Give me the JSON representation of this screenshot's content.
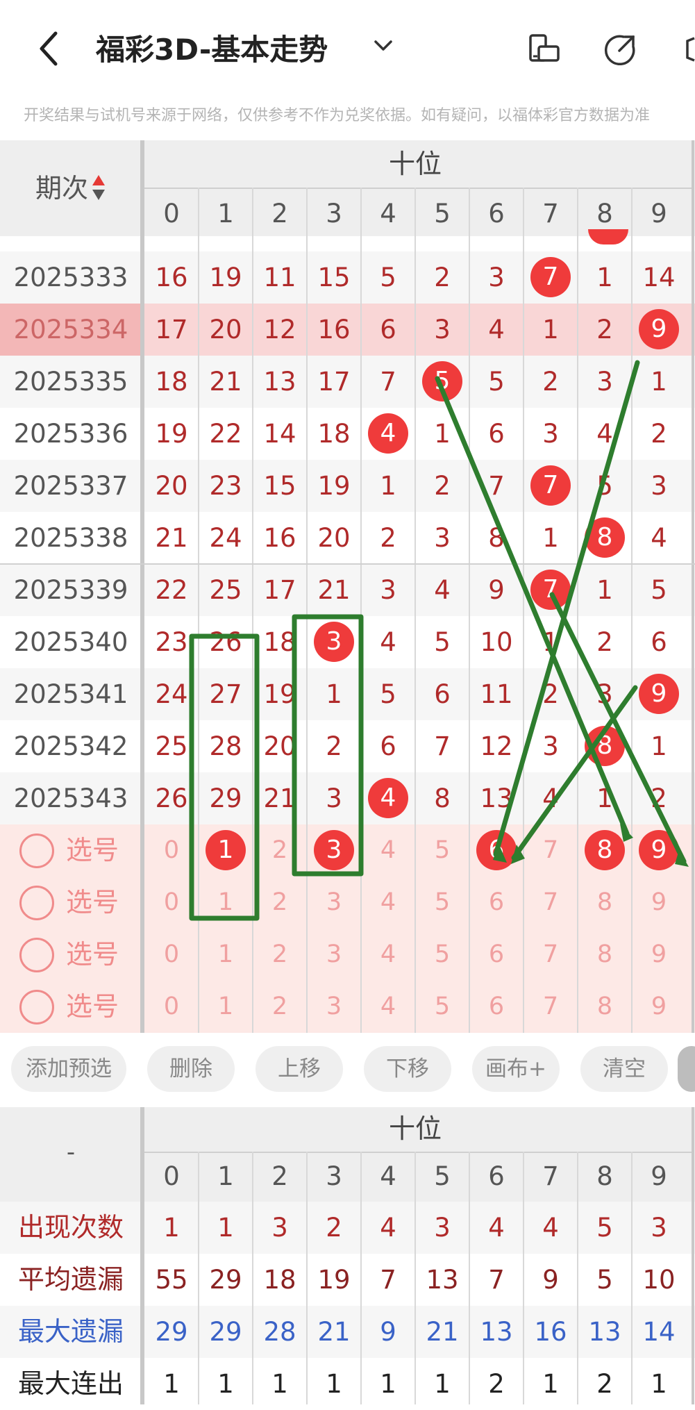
{
  "header": {
    "back_icon": "chevron-left-icon",
    "title": "福彩3D-基本走势",
    "dropdown_icon": "chevron-down-icon",
    "icons": [
      "phone-rotate-icon",
      "share-icon",
      "more-icon"
    ]
  },
  "notice": "开奖结果与试机号来源于网络，仅供参考不作为兑奖依据。如有疑问，以福体彩官方数据为准",
  "table": {
    "period_header": "期次",
    "group_header": "十位",
    "digits": [
      "0",
      "1",
      "2",
      "3",
      "4",
      "5",
      "6",
      "7",
      "8",
      "9"
    ],
    "rows": [
      {
        "period": "2025333",
        "values": [
          "16",
          "19",
          "11",
          "15",
          "5",
          "2",
          "3",
          "7",
          "1",
          "14"
        ],
        "hit": 7,
        "highlight": false
      },
      {
        "period": "2025334",
        "values": [
          "17",
          "20",
          "12",
          "16",
          "6",
          "3",
          "4",
          "1",
          "2",
          "9"
        ],
        "hit": 9,
        "highlight": true
      },
      {
        "period": "2025335",
        "values": [
          "18",
          "21",
          "13",
          "17",
          "7",
          "5",
          "5",
          "2",
          "3",
          "1"
        ],
        "hit": 5,
        "highlight": false
      },
      {
        "period": "2025336",
        "values": [
          "19",
          "22",
          "14",
          "18",
          "4",
          "1",
          "6",
          "3",
          "4",
          "2"
        ],
        "hit": 4,
        "highlight": false
      },
      {
        "period": "2025337",
        "values": [
          "20",
          "23",
          "15",
          "19",
          "1",
          "2",
          "7",
          "7",
          "5",
          "3"
        ],
        "hit": 7,
        "highlight": false
      },
      {
        "period": "2025338",
        "values": [
          "21",
          "24",
          "16",
          "20",
          "2",
          "3",
          "8",
          "1",
          "8",
          "4"
        ],
        "hit": 8,
        "highlight": false
      },
      {
        "period": "2025339",
        "values": [
          "22",
          "25",
          "17",
          "21",
          "3",
          "4",
          "9",
          "7",
          "1",
          "5"
        ],
        "hit": 7,
        "highlight": false
      },
      {
        "period": "2025340",
        "values": [
          "23",
          "26",
          "18",
          "3",
          "4",
          "5",
          "10",
          "1",
          "2",
          "6"
        ],
        "hit": 3,
        "highlight": false
      },
      {
        "period": "2025341",
        "values": [
          "24",
          "27",
          "19",
          "1",
          "5",
          "6",
          "11",
          "2",
          "3",
          "9"
        ],
        "hit": 9,
        "highlight": false
      },
      {
        "period": "2025342",
        "values": [
          "25",
          "28",
          "20",
          "2",
          "6",
          "7",
          "12",
          "3",
          "8",
          "1"
        ],
        "hit": 8,
        "highlight": false
      },
      {
        "period": "2025343",
        "values": [
          "26",
          "29",
          "21",
          "3",
          "4",
          "8",
          "13",
          "4",
          "1",
          "2"
        ],
        "hit": 4,
        "highlight": false
      }
    ],
    "pick_rows": [
      {
        "label": "选号",
        "selected": [
          1,
          3,
          6,
          8,
          9
        ]
      },
      {
        "label": "选号",
        "selected": []
      },
      {
        "label": "选号",
        "selected": []
      },
      {
        "label": "选号",
        "selected": []
      }
    ]
  },
  "buttons": [
    "添加预选",
    "删除",
    "上移",
    "下移",
    "画布+",
    "清空"
  ],
  "stats": {
    "corner": "-",
    "group_header": "十位",
    "rows": [
      {
        "label": "出现次数",
        "color": "#b02a2a",
        "values": [
          "1",
          "1",
          "3",
          "2",
          "4",
          "3",
          "4",
          "4",
          "5",
          "3"
        ]
      },
      {
        "label": "平均遗漏",
        "color": "#8a2222",
        "values": [
          "55",
          "29",
          "18",
          "19",
          "7",
          "13",
          "7",
          "9",
          "5",
          "10"
        ]
      },
      {
        "label": "最大遗漏",
        "color": "#3a62c7",
        "values": [
          "29",
          "29",
          "28",
          "21",
          "9",
          "21",
          "13",
          "16",
          "13",
          "14"
        ]
      },
      {
        "label": "最大连出",
        "color": "#222222",
        "values": [
          "1",
          "1",
          "1",
          "1",
          "1",
          "1",
          "2",
          "1",
          "2",
          "1"
        ]
      }
    ]
  },
  "colors": {
    "ball": "#ef3b3b",
    "highlight_row": "#f9d6d6",
    "pick_bg": "#fde9e6",
    "annotation": "#2e7d2e"
  }
}
